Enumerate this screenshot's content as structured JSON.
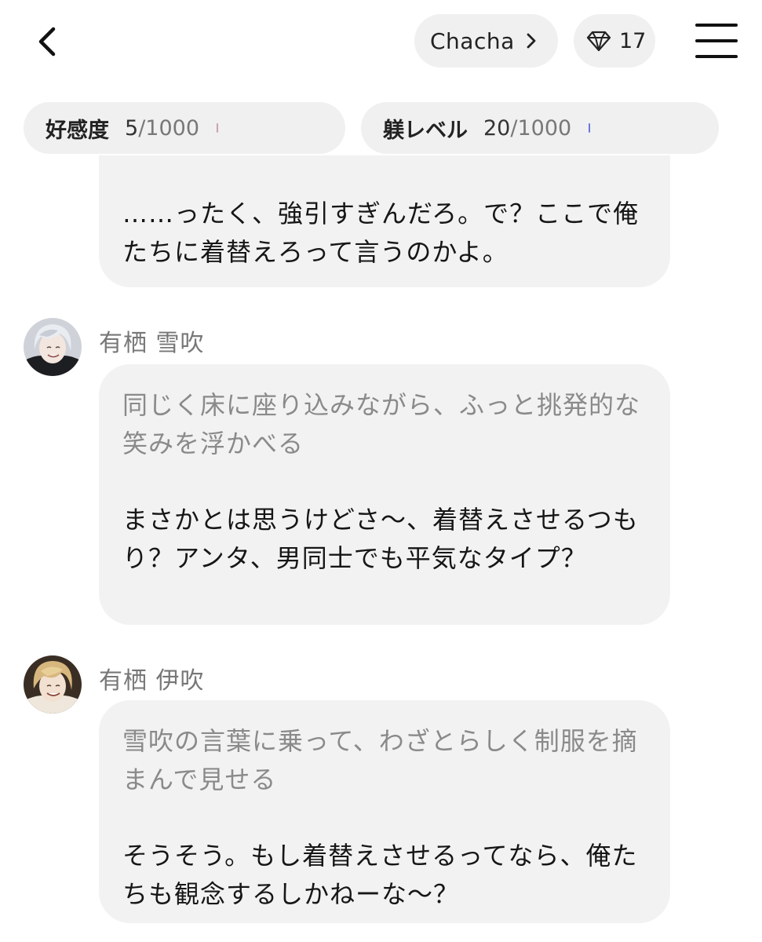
{
  "header": {
    "character_name": "Chacha",
    "gem_count": "17",
    "icons": {
      "back": "chevron-left-icon",
      "character_arrow": "chevron-right-icon",
      "gem": "diamond-icon",
      "menu": "hamburger-menu-icon"
    }
  },
  "stats": {
    "affection": {
      "label": "好感度",
      "current": "5",
      "max": "/1000",
      "progress": 0.005,
      "color": "#c9a0b0"
    },
    "discipline": {
      "label": "躾レベル",
      "current": "20",
      "max": "/1000",
      "progress": 0.02,
      "color": "#6a78d8"
    }
  },
  "messages": [
    {
      "speech": "……ったく、強引すぎんだろ。で？ここで俺たちに着替えろって言うのかよ。"
    },
    {
      "sender": "有栖 雪吹",
      "action": "同じく床に座り込みながら、ふっと挑発的な笑みを浮かべる",
      "speech": "まさかとは思うけどさ〜、着替えさせるつもり？アンタ、男同士でも平気なタイプ？"
    },
    {
      "sender": "有栖 伊吹",
      "action": "雪吹の言葉に乗って、わざとらしく制服を摘まんで見せる",
      "speech": "そうそう。もし着替えさせるってなら、俺たちも観念するしかねーな〜？"
    }
  ],
  "colors": {
    "bubble_bg": "#f2f2f2",
    "pill_bg": "#f0f0f0",
    "action_text": "#8a8a8a",
    "speech_text": "#161616"
  }
}
